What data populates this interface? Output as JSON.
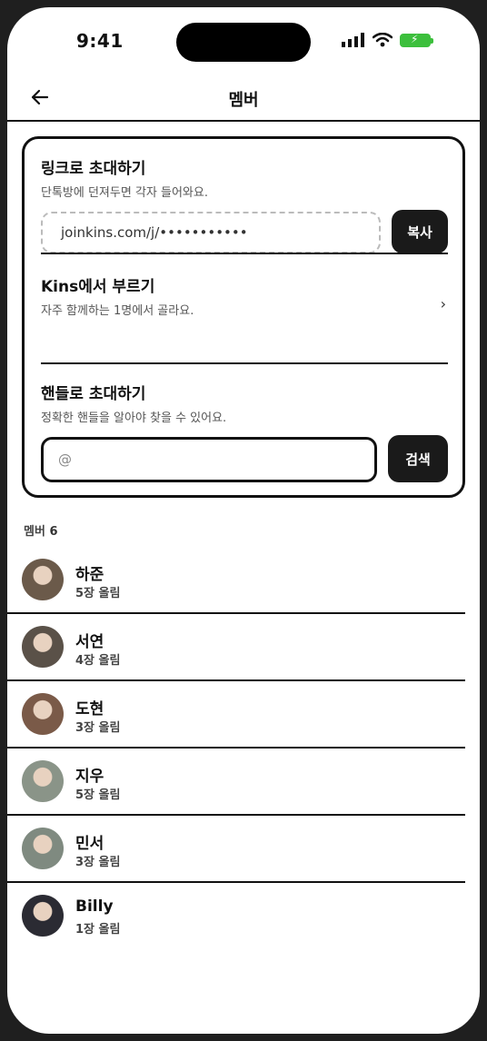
{
  "status": {
    "time": "9:41"
  },
  "header": {
    "title": "멤버"
  },
  "invite_link": {
    "title": "링크로 초대하기",
    "desc": "단톡방에 던져두면 각자 들어와요.",
    "url": "joinkins.com/j/•••••••••••",
    "copy_label": "복사"
  },
  "invite_kins": {
    "title": "Kins에서 부르기",
    "desc": "자주 함께하는 1명에서 골라요.",
    "chevron": "›"
  },
  "invite_handle": {
    "title": "핸들로 초대하기",
    "desc": "정확한 핸들을 알아야 찾을 수 있어요.",
    "placeholder": "@",
    "search_label": "검색"
  },
  "members": {
    "label": "멤버",
    "count": "6",
    "items": [
      {
        "name": "하준",
        "uploads": "5장 올림",
        "avatar_color": "#6b5a4a"
      },
      {
        "name": "서연",
        "uploads": "4장 올림",
        "avatar_color": "#5a5148"
      },
      {
        "name": "도현",
        "uploads": "3장 올림",
        "avatar_color": "#7a5a48"
      },
      {
        "name": "지우",
        "uploads": "5장 올림",
        "avatar_color": "#8a9488"
      },
      {
        "name": "민서",
        "uploads": "3장 올림",
        "avatar_color": "#7f8a80"
      },
      {
        "name": "Billy",
        "uploads": "1장 올림",
        "avatar_color": "#2b2b33"
      }
    ]
  }
}
